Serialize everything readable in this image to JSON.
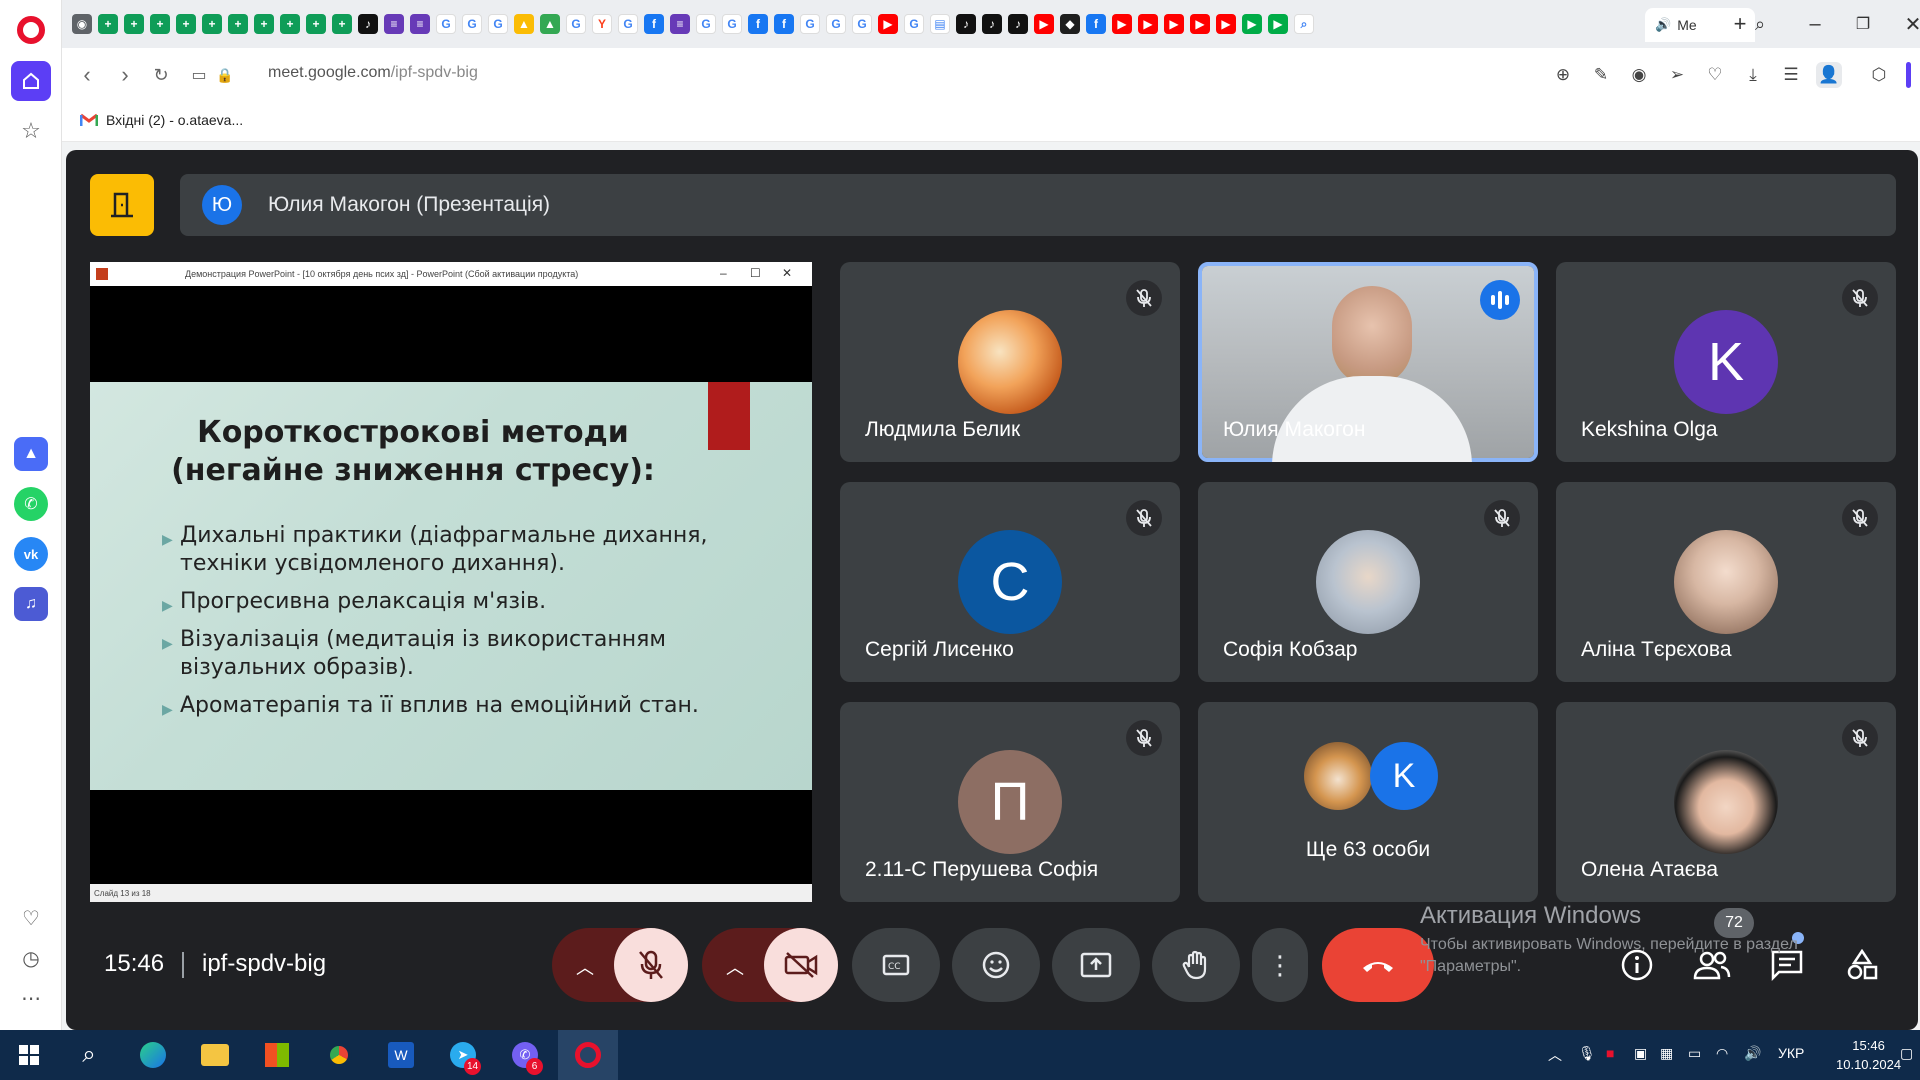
{
  "browser": {
    "url_domain": "meet.google.com",
    "url_path": "/ipf-spdv-big",
    "active_tab_label": "Me",
    "bookmark_label": "Вхідні (2) - o.ataeva..."
  },
  "meet": {
    "presenter_initial": "Ю",
    "presenter_banner": "Юлия Макогон (Презентація)",
    "clock": "15:46",
    "meeting_code": "ipf-spdv-big",
    "people_count": "72"
  },
  "presentation": {
    "window_title": "Демонстрация PowerPoint - [10 октября день псих зд] - PowerPoint (Сбой активации продукта)",
    "slide_title_line1": "Короткострокові методи",
    "slide_title_line2": "(негайне зниження стресу):",
    "bullets": [
      "Дихальні практики (діафрагмальне дихання, техніки усвідомленого дихання).",
      "Прогресивна релаксація м'язів.",
      "Візуалізація (медитація із використанням візуальних образів).",
      "Ароматерапія та її вплив на емоційний стан."
    ],
    "status_text": "Слайд 13 из 18"
  },
  "participants": [
    {
      "name": "Людмила Белик",
      "initial": "",
      "avatar_type": "cake-photo",
      "muted": true
    },
    {
      "name": "Юлия Макогон",
      "initial": "",
      "avatar_type": "video",
      "muted": false
    },
    {
      "name": "Kekshina Olga",
      "initial": "K",
      "avatar_type": "letter",
      "color": "#5e35b1",
      "muted": true
    },
    {
      "name": "Сергій Лисенко",
      "initial": "С",
      "avatar_type": "letter",
      "color": "#0b57a0",
      "muted": true
    },
    {
      "name": "Софія Кобзар",
      "initial": "",
      "avatar_type": "child-photo",
      "muted": true
    },
    {
      "name": "Аліна Тєрєхова",
      "initial": "",
      "avatar_type": "woman-photo",
      "muted": true
    },
    {
      "name": "2.11-С Перушева Софія",
      "initial": "П",
      "avatar_type": "letter",
      "color": "#8d6e63",
      "muted": true
    },
    {
      "name": "Олена Атаєва",
      "initial": "",
      "avatar_type": "woman-photo-2",
      "muted": true
    }
  ],
  "more_tile": {
    "label": "Ще 63 особи",
    "initial": "K"
  },
  "activation": {
    "line1": "Активация Windows",
    "line2": "Чтобы активировать Windows, перейдите в раздел",
    "line3": "\"Параметры\"."
  },
  "taskbar": {
    "time": "15:46",
    "date": "10.10.2024",
    "lang": "УКР",
    "telegram_badge": "14",
    "viber_badge": "6"
  },
  "colors": {
    "meet_bg": "#202124",
    "tile_bg": "#3c4043",
    "end_call": "#ea4335",
    "speaking_outline": "#8ab4f8",
    "opera_red": "#e8112d",
    "opera_accent": "#5c3ef5"
  }
}
